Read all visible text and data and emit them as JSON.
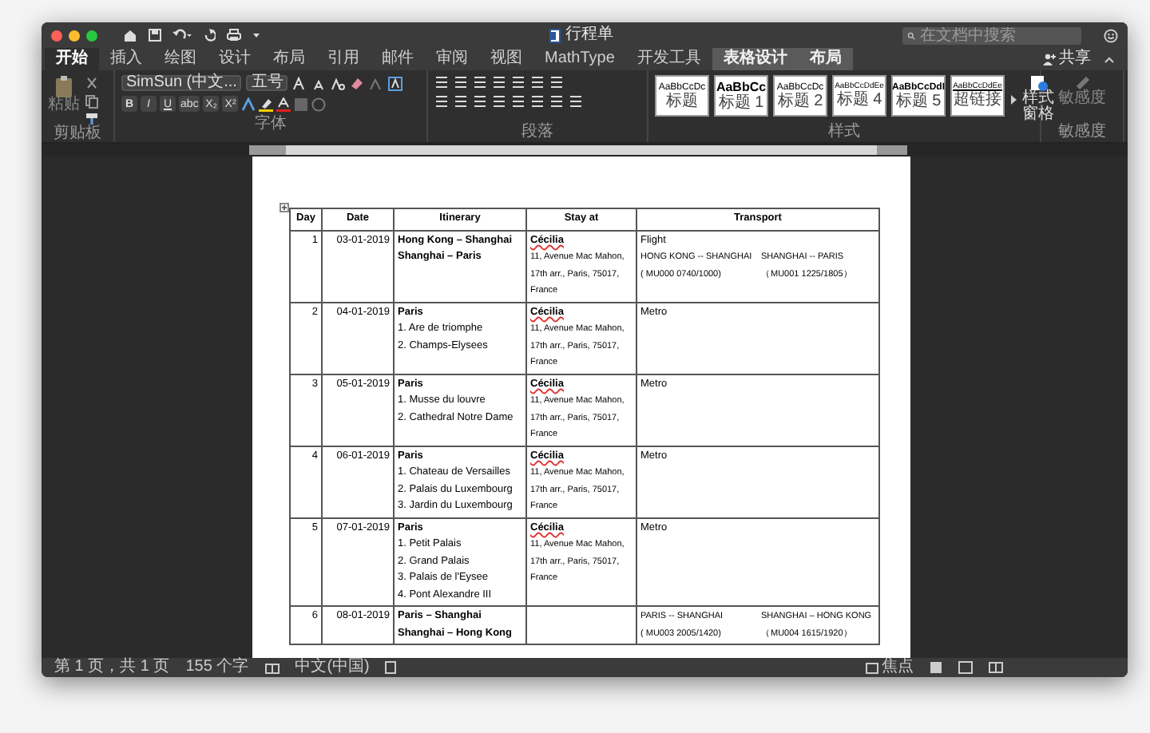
{
  "window": {
    "title": "行程单"
  },
  "search": {
    "placeholder": "在文档中搜索"
  },
  "tabs": [
    {
      "label": "开始",
      "selected": true,
      "kind": "main"
    },
    {
      "label": "插入",
      "selected": false,
      "kind": "main"
    },
    {
      "label": "绘图",
      "selected": false,
      "kind": "main"
    },
    {
      "label": "设计",
      "selected": false,
      "kind": "main"
    },
    {
      "label": "布局",
      "selected": false,
      "kind": "main"
    },
    {
      "label": "引用",
      "selected": false,
      "kind": "main"
    },
    {
      "label": "邮件",
      "selected": false,
      "kind": "main"
    },
    {
      "label": "审阅",
      "selected": false,
      "kind": "main"
    },
    {
      "label": "视图",
      "selected": false,
      "kind": "main"
    },
    {
      "label": "MathType",
      "selected": false,
      "kind": "main"
    },
    {
      "label": "开发工具",
      "selected": false,
      "kind": "main"
    },
    {
      "label": "表格设计",
      "selected": false,
      "kind": "contextual"
    },
    {
      "label": "布局",
      "selected": false,
      "kind": "contextual"
    }
  ],
  "share": "共享",
  "ribbon": {
    "paste_label": "粘贴",
    "font_name": "SimSun (中文...",
    "font_size": "五号",
    "format_buttons": [
      "B",
      "I",
      "U",
      "abc",
      "X₂",
      "X²"
    ],
    "styles": [
      {
        "preview": "AaBbCcDc",
        "label": "标题",
        "kind": "normal"
      },
      {
        "preview": "AaBbCc",
        "label": "标题 1",
        "kind": "heading"
      },
      {
        "preview": "AaBbCcDc",
        "label": "标题 2",
        "kind": "normal"
      },
      {
        "preview": "AaBbCcDdEe",
        "label": "标题 4",
        "kind": "small"
      },
      {
        "preview": "AaBbCcDdI",
        "label": "标题 5",
        "kind": "bold"
      },
      {
        "preview": "AaBbCcDdEe",
        "label": "超链接",
        "kind": "link"
      }
    ],
    "styles_pane": "样式窗格",
    "sensitivity": "敏感度",
    "groups": [
      "剪贴板",
      "字体",
      "段落",
      "样式",
      "敏感度"
    ]
  },
  "table": {
    "columns": [
      "Day",
      "Date",
      "Itinerary",
      "Stay at",
      "Transport"
    ],
    "rows": [
      {
        "day": "1",
        "date": "03-01-2019",
        "itinerary": {
          "titles": [
            "Hong Kong – Shanghai",
            "Shanghai – Paris"
          ]
        },
        "stay": {
          "name": "Cécilia",
          "address": [
            "11, Avenue Mac Mahon,",
            "17th arr., Paris, 75017,",
            "France"
          ]
        },
        "transport": {
          "mode": "Flight",
          "legs": [
            {
              "route": "HONG KONG -- SHANGHAI",
              "flight": "( MU000 0740/1000)"
            },
            {
              "route": "SHANGHAI -- PARIS",
              "flight": "（MU001 1225/1805）"
            }
          ]
        }
      },
      {
        "day": "2",
        "date": "04-01-2019",
        "itinerary": {
          "titles": [
            "Paris"
          ],
          "items": [
            "1. Are de triomphe",
            "2. Champs-Elysees"
          ]
        },
        "stay": {
          "name": "Cécilia",
          "address": [
            "11, Avenue Mac Mahon,",
            "17th arr., Paris, 75017,",
            "France"
          ]
        },
        "transport": {
          "mode": "Metro"
        }
      },
      {
        "day": "3",
        "date": "05-01-2019",
        "itinerary": {
          "titles": [
            "Paris"
          ],
          "items": [
            "1. Musse du louvre",
            "2. Cathedral Notre Dame"
          ]
        },
        "stay": {
          "name": "Cécilia",
          "address": [
            "11, Avenue Mac Mahon,",
            "17th arr., Paris, 75017,",
            "France"
          ]
        },
        "transport": {
          "mode": "Metro"
        }
      },
      {
        "day": "4",
        "date": "06-01-2019",
        "itinerary": {
          "titles": [
            "Paris"
          ],
          "items": [
            "1. Chateau de Versailles",
            "2. Palais du Luxembourg",
            "3. Jardin du Luxembourg"
          ]
        },
        "stay": {
          "name": "Cécilia",
          "address": [
            "11, Avenue Mac Mahon,",
            "17th arr., Paris, 75017,",
            "France"
          ]
        },
        "transport": {
          "mode": "Metro"
        }
      },
      {
        "day": "5",
        "date": "07-01-2019",
        "itinerary": {
          "titles": [
            "Paris"
          ],
          "items": [
            "1. Petit Palais",
            "2. Grand Palais",
            "3. Palais de l'Eysee",
            "4. Pont Alexandre III"
          ]
        },
        "stay": {
          "name": "Cécilia",
          "address": [
            "11, Avenue Mac Mahon,",
            "17th arr., Paris, 75017,",
            "France"
          ]
        },
        "transport": {
          "mode": "Metro"
        }
      },
      {
        "day": "6",
        "date": "08-01-2019",
        "itinerary": {
          "titles": [
            "Paris – Shanghai",
            "Shanghai – Hong Kong"
          ]
        },
        "transport": {
          "legs": [
            {
              "route": "PARIS -- SHANGHAI",
              "flight": "( MU003 2005/1420)"
            },
            {
              "route": "SHANGHAI – HONG KONG",
              "flight": "（MU004 1615/1920）"
            }
          ]
        }
      }
    ]
  },
  "status_bar": {
    "page": "第 1 页，共 1 页",
    "words": "155 个字",
    "language": "中文(中国)",
    "focus": "焦点"
  }
}
